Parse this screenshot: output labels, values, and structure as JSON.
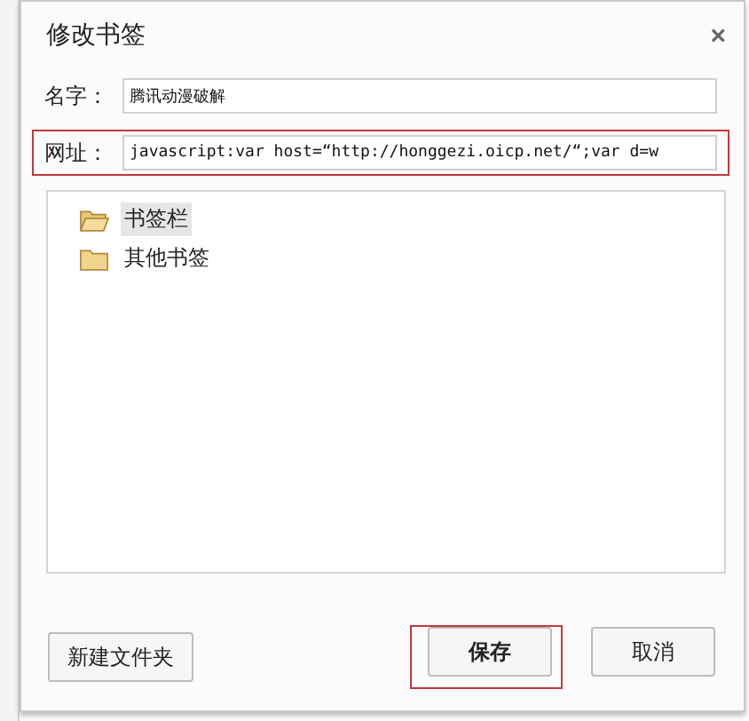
{
  "dialog": {
    "title": "修改书签",
    "close": "×"
  },
  "fields": [
    {
      "label": "名字：",
      "value": "腾讯动漫破解",
      "highlighted": false
    },
    {
      "label": "网址：",
      "value": "javascript:var host=“http://honggezi.oicp.net/“;var d=w",
      "highlighted": true
    }
  ],
  "folders": [
    {
      "name": "书签栏",
      "selected": true,
      "expanded": true
    },
    {
      "name": "其他书签",
      "selected": false,
      "expanded": false
    }
  ],
  "buttons": [
    {
      "label": "新建文件夹",
      "kind": "secondary",
      "highlighted": false
    },
    {
      "label": "保存",
      "kind": "primary",
      "highlighted": true
    },
    {
      "label": "取消",
      "kind": "secondary",
      "highlighted": false
    }
  ]
}
